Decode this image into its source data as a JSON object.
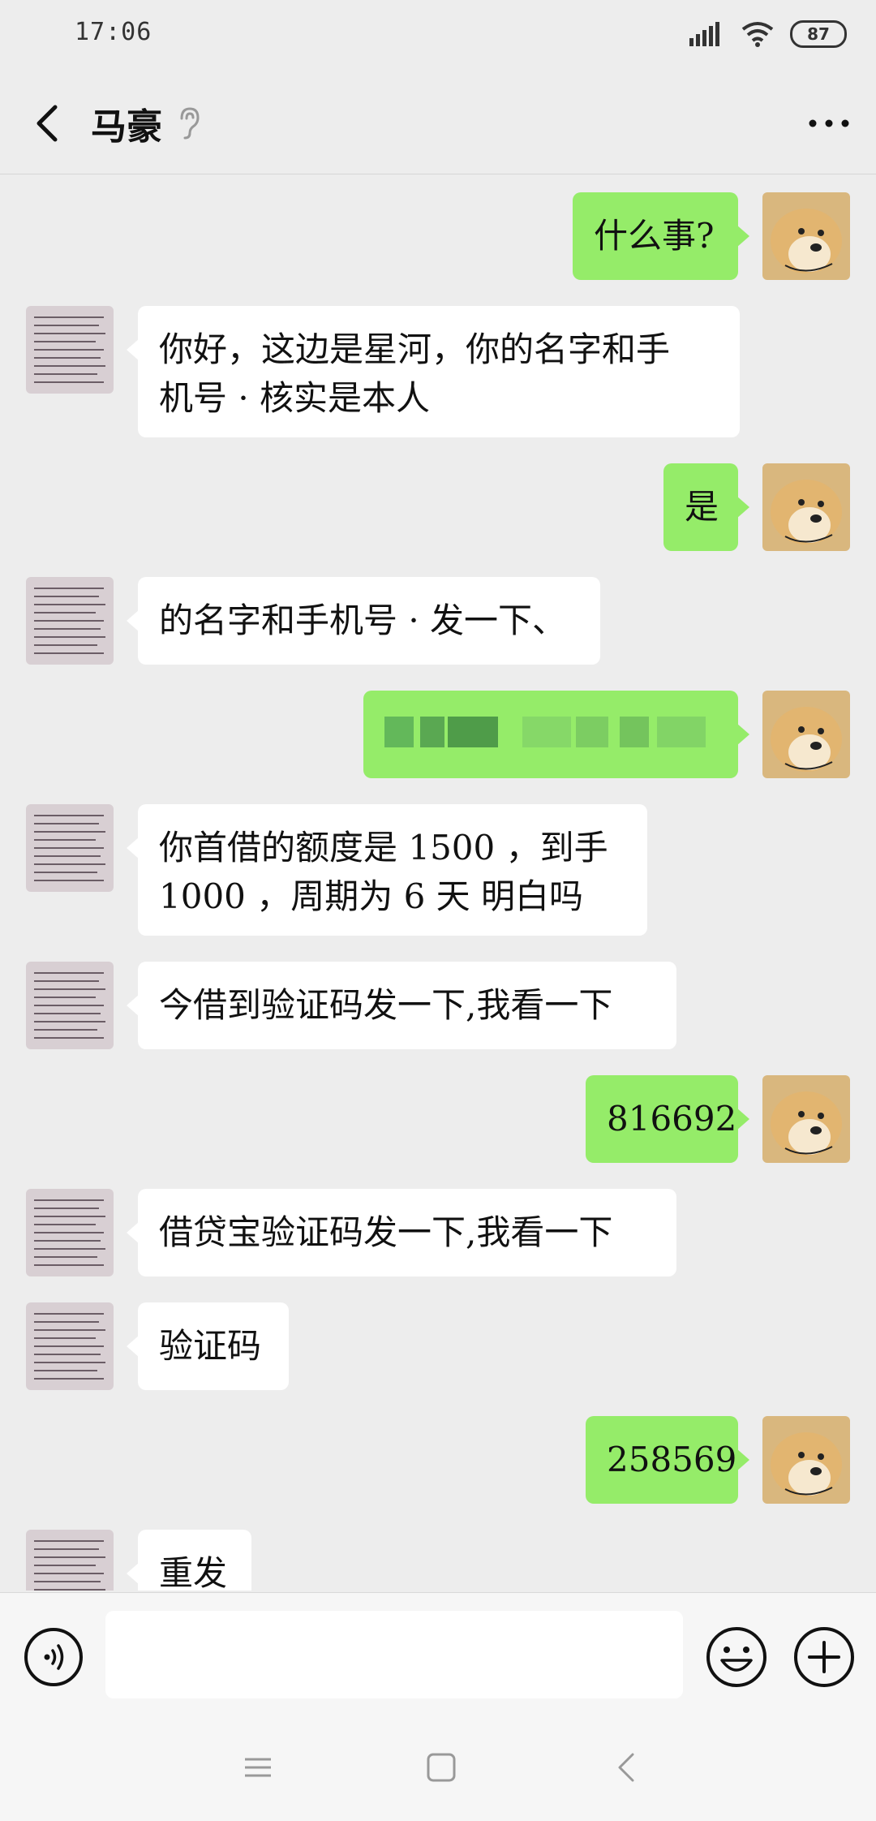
{
  "status_bar": {
    "time": "17:06",
    "battery": "87"
  },
  "header": {
    "title": "马豪",
    "back_icon": "chevron-left-icon",
    "more_icon": "more-dots-icon",
    "ear_icon": "ear-icon"
  },
  "messages": [
    {
      "from": "me",
      "text": "什么事?"
    },
    {
      "from": "them",
      "line1": "你好，这边是星河，你的名字和手",
      "line2": "机号 · 核实是本人"
    },
    {
      "from": "me",
      "text": "是"
    },
    {
      "from": "them",
      "text": "的名字和手机号 · 发一下、"
    },
    {
      "from": "me",
      "text": "",
      "redacted": true
    },
    {
      "from": "them",
      "line1": " 你首借的额度是 1500 ，到手",
      "line2": "1000 ，周期为 6 天 明白吗"
    },
    {
      "from": "them",
      "text": "今借到验证码发一下,我看一下"
    },
    {
      "from": "me",
      "text": "816692"
    },
    {
      "from": "them",
      "text": "借贷宝验证码发一下,我看一下"
    },
    {
      "from": "them",
      "text": "验证码"
    },
    {
      "from": "me",
      "text": "258569"
    },
    {
      "from": "them",
      "text": "重发"
    }
  ],
  "input_bar": {
    "placeholder": ""
  },
  "colors": {
    "sent_bubble": "#95ec69",
    "received_bubble": "#ffffff",
    "background": "#ededed"
  }
}
